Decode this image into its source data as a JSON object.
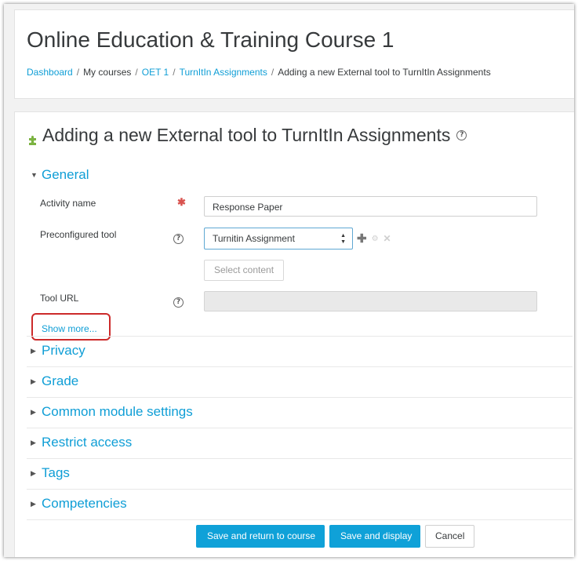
{
  "page": {
    "title": "Online Education & Training Course 1"
  },
  "breadcrumb": {
    "items": [
      "Dashboard",
      "My courses",
      "OET 1",
      "TurnItIn Assignments",
      "Adding a new External tool to TurnItIn Assignments"
    ],
    "separator": "/"
  },
  "form": {
    "heading": "Adding a new External tool to TurnItIn Assignments",
    "help_glyph": "?",
    "sections": {
      "general": "General",
      "privacy": "Privacy",
      "grade": "Grade",
      "common": "Common module settings",
      "restrict": "Restrict access",
      "tags": "Tags",
      "competencies": "Competencies"
    },
    "fields": {
      "activity_name_label": "Activity name",
      "activity_name_value": "Response Paper",
      "required_glyph": "✱",
      "preconfigured_label": "Preconfigured tool",
      "preconfigured_value": "Turnitin Assignment",
      "select_content_label": "Select content",
      "tool_url_label": "Tool URL",
      "tool_url_value": ""
    },
    "show_more": "Show more...",
    "buttons": {
      "save_return": "Save and return to course",
      "save_display": "Save and display",
      "cancel": "Cancel"
    }
  },
  "colors": {
    "link": "#0f9ed6",
    "primary_button": "#0fa1d8",
    "highlight_box": "#cc2a2a",
    "required": "#d9534f"
  },
  "icons": {
    "heading": "puzzle-icon",
    "help": "question-circle-icon",
    "add": "plus-icon",
    "edit": "gear-icon",
    "delete": "x-icon",
    "expanded": "caret-down-icon",
    "collapsed": "caret-right-icon"
  }
}
